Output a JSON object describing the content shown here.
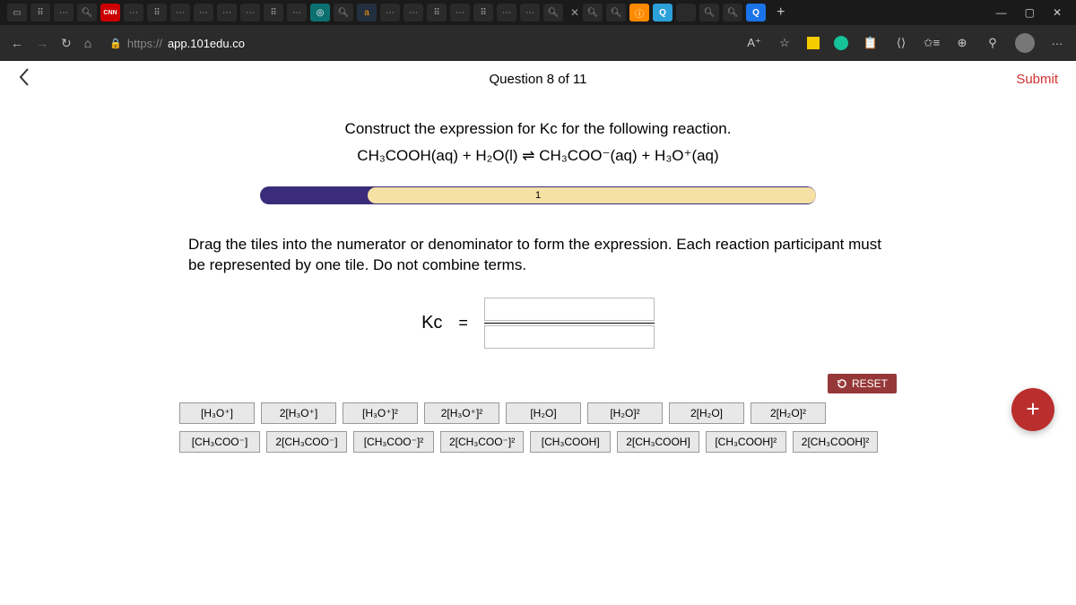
{
  "browser": {
    "url_scheme": "https://",
    "url_host": "app.101edu.co",
    "tab_cnn": "CNN",
    "tab_amazon": "a",
    "plus": "+",
    "win_min": "—",
    "win_max": "▢",
    "win_close": "✕",
    "tab_close": "✕",
    "addr_read": "A⁺",
    "more": "···"
  },
  "header": {
    "question_counter": "Question 8 of 11",
    "submit": "Submit"
  },
  "prompt": {
    "line1": "Construct the expression for Kc for the following reaction.",
    "equation": "CH₃COOH(aq) + H₂O(l) ⇌ CH₃COO⁻(aq) + H₃O⁺(aq)"
  },
  "progress": {
    "label": "1"
  },
  "instructions": "Drag the tiles into the numerator or denominator to form the expression. Each reaction participant must be represented by one tile. Do not combine terms.",
  "kc": {
    "label": "Kc",
    "equals": "="
  },
  "reset": "RESET",
  "tiles": {
    "r1": [
      "[H₃O⁺]",
      "2[H₃O⁺]",
      "[H₃O⁺]²",
      "2[H₃O⁺]²",
      "[H₂O]",
      "[H₂O]²",
      "2[H₂O]",
      "2[H₂O]²"
    ],
    "r2": [
      "[CH₃COO⁻]",
      "2[CH₃COO⁻]",
      "[CH₃COO⁻]²",
      "2[CH₃COO⁻]²",
      "[CH₃COOH]",
      "2[CH₃COOH]",
      "[CH₃COOH]²",
      "2[CH₃COOH]²"
    ]
  },
  "fab": "+"
}
